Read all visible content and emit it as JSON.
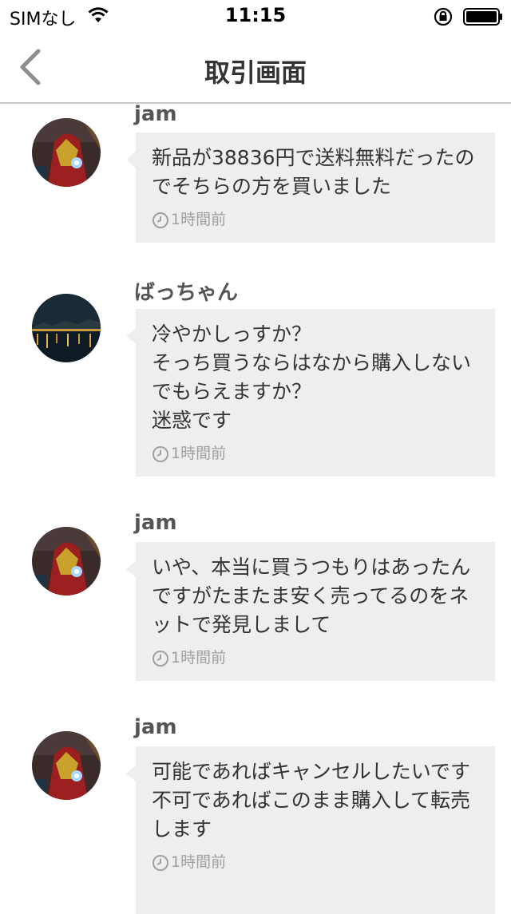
{
  "status_bar": {
    "carrier": "SIMなし",
    "time": "11:15",
    "icons": [
      "wifi-icon",
      "orientation-lock-icon",
      "battery-icon"
    ]
  },
  "nav": {
    "title": "取引画面",
    "back_icon": "chevron-left-icon"
  },
  "messages": [
    {
      "sender": "jam",
      "avatar": "ironman-avatar",
      "text": "新品が38836円で送料無料だったのでそちらの方を買いました",
      "time": "1時間前"
    },
    {
      "sender": "ばっちゃん",
      "avatar": "night-city-avatar",
      "text": "冷やかしっすか？\nそっち買うならはなから購入しないでもらえますか？\n迷惑です",
      "time": "1時間前"
    },
    {
      "sender": "jam",
      "avatar": "ironman-avatar",
      "text": "いや、本当に買うつもりはあったんですがたまたま安く売ってるのをネットで発見しまして",
      "time": "1時間前"
    },
    {
      "sender": "jam",
      "avatar": "ironman-avatar",
      "text": "可能であればキャンセルしたいです\n不可であればこのまま購入して転売します",
      "time": "1時間前"
    }
  ],
  "colors": {
    "bubble": "#eeeeee",
    "divider": "#c9c9c9",
    "time_text": "#a0a0a0"
  }
}
